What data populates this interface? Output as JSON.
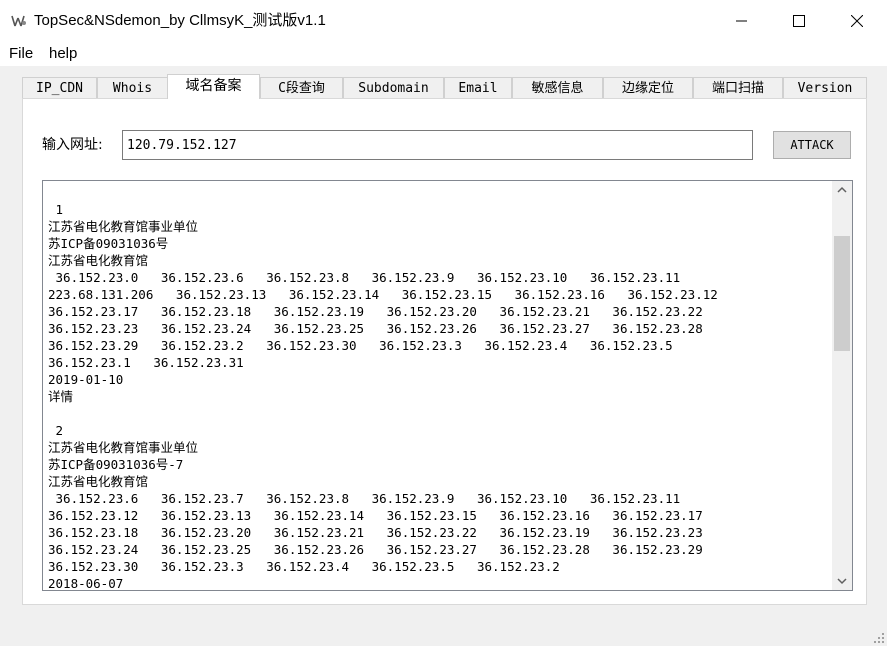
{
  "window": {
    "title": "TopSec&NSdemon_by CllmsyK_测试版v1.1",
    "icons": [
      "app-icon",
      "minimize-icon",
      "maximize-icon",
      "close-icon"
    ]
  },
  "menu": {
    "items": [
      "File",
      "help"
    ]
  },
  "tabs": {
    "items": [
      "IP_CDN",
      "Whois",
      "域名备案",
      "C段查询",
      "Subdomain",
      "Email",
      "敏感信息",
      "边缘定位",
      "端口扫描",
      "Version"
    ],
    "active": "域名备案"
  },
  "form": {
    "url_label": "输入网址:",
    "url_value": "120.79.152.127",
    "attack_label": "ATTACK"
  },
  "output": {
    "text": " 1\n江苏省电化教育馆事业单位\n苏ICP备09031036号\n江苏省电化教育馆\n 36.152.23.0   36.152.23.6   36.152.23.8   36.152.23.9   36.152.23.10   36.152.23.11\n223.68.131.206   36.152.23.13   36.152.23.14   36.152.23.15   36.152.23.16   36.152.23.12\n36.152.23.17   36.152.23.18   36.152.23.19   36.152.23.20   36.152.23.21   36.152.23.22\n36.152.23.23   36.152.23.24   36.152.23.25   36.152.23.26   36.152.23.27   36.152.23.28\n36.152.23.29   36.152.23.2   36.152.23.30   36.152.23.3   36.152.23.4   36.152.23.5\n36.152.23.1   36.152.23.31\n2019-01-10\n详情\n\n 2\n江苏省电化教育馆事业单位\n苏ICP备09031036号-7\n江苏省电化教育馆\n 36.152.23.6   36.152.23.7   36.152.23.8   36.152.23.9   36.152.23.10   36.152.23.11\n36.152.23.12   36.152.23.13   36.152.23.14   36.152.23.15   36.152.23.16   36.152.23.17\n36.152.23.18   36.152.23.20   36.152.23.21   36.152.23.22   36.152.23.19   36.152.23.23\n36.152.23.24   36.152.23.25   36.152.23.26   36.152.23.27   36.152.23.28   36.152.23.29\n36.152.23.30   36.152.23.3   36.152.23.4   36.152.23.5   36.152.23.2\n2018-06-07",
    "scroll_position": 0.2
  },
  "colors": {
    "window_bg": "#f0f0f0",
    "panel_bg": "#ffffff",
    "border": "#d0d0d0",
    "scroll_thumb": "#cdcdcd"
  }
}
